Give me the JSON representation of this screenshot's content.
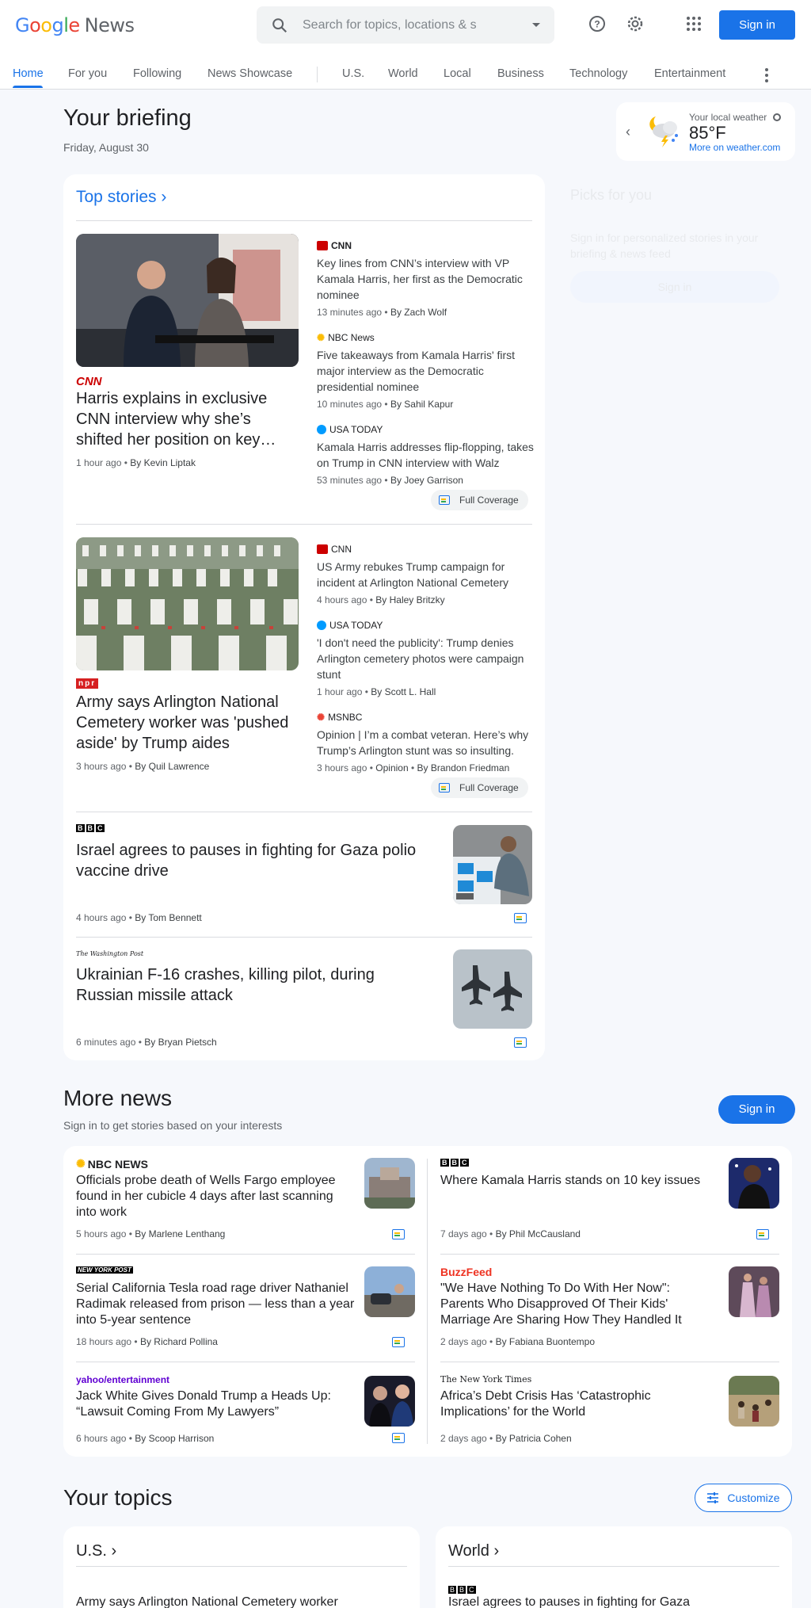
{
  "header": {
    "logo_google": "Google",
    "logo_news": "News",
    "search_placeholder": "Search for topics, locations & s",
    "signin": "Sign in",
    "tabs": [
      "Home",
      "For you",
      "Following",
      "News Showcase",
      "U.S.",
      "World",
      "Local",
      "Business",
      "Technology",
      "Entertainment"
    ],
    "active_tab": "Home"
  },
  "briefing": {
    "title": "Your briefing",
    "date": "Friday, August 30"
  },
  "weather": {
    "label": "Your local weather",
    "temp": "85°F",
    "link": "More on weather.com"
  },
  "top_stories": {
    "title": "Top stories",
    "cluster1": {
      "main_source": "CNN",
      "main_title": "Harris explains in exclusive CNN interview why she’s shifted her position on key…",
      "main_time": "1 hour ago",
      "main_author": "By Kevin Liptak",
      "related": [
        {
          "source": "CNN",
          "title": "Key lines from CNN’s interview with VP Kamala Harris, her first as the Democratic nominee",
          "time": "13 minutes ago",
          "author": "By Zach Wolf"
        },
        {
          "source": "NBC News",
          "title": "Five takeaways from Kamala Harris' first major interview as the Democratic presidential nominee",
          "time": "10 minutes ago",
          "author": "By Sahil Kapur"
        },
        {
          "source": "USA TODAY",
          "title": "Kamala Harris addresses flip-flopping, takes on Trump in CNN interview with Walz",
          "time": "53 minutes ago",
          "author": "By Joey Garrison"
        }
      ],
      "full_coverage": "Full Coverage"
    },
    "cluster2": {
      "main_source": "npr",
      "main_title": "Army says Arlington National Cemetery worker was 'pushed aside' by Trump aides",
      "main_time": "3 hours ago",
      "main_author": "By Quil Lawrence",
      "related": [
        {
          "source": "CNN",
          "title": "US Army rebukes Trump campaign for incident at Arlington National Cemetery",
          "time": "4 hours ago",
          "author": "By Haley Britzky"
        },
        {
          "source": "USA TODAY",
          "title": "'I don't need the publicity': Trump denies Arlington cemetery photos were campaign stunt",
          "time": "1 hour ago",
          "author": "By Scott L. Hall"
        },
        {
          "source": "MSNBC",
          "title": "Opinion | I’m a combat veteran. Here’s why Trump’s Arlington stunt was so insulting.",
          "time": "3 hours ago",
          "extra": "Opinion",
          "author": "By Brandon Friedman"
        }
      ],
      "full_coverage": "Full Coverage"
    },
    "single1": {
      "source": "BBC",
      "title": "Israel agrees to pauses in fighting for Gaza polio vaccine drive",
      "time": "4 hours ago",
      "author": "By Tom Bennett"
    },
    "single2": {
      "source": "The Washington Post",
      "title": "Ukrainian F-16 crashes, killing pilot, during Russian missile attack",
      "time": "6 minutes ago",
      "author": "By Bryan Pietsch"
    }
  },
  "picks": {
    "title": "Picks for you",
    "text": "Sign in for personalized stories in your briefing & news feed",
    "button": "Sign in"
  },
  "more_news": {
    "title": "More news",
    "subtitle": "Sign in to get stories based on your interests",
    "signin": "Sign in",
    "items": [
      {
        "source": "NBC NEWS",
        "title": "Officials probe death of Wells Fargo employee found in her cubicle 4 days after last scanning into work",
        "time": "5 hours ago",
        "author": "By Marlene Lenthang"
      },
      {
        "source": "BBC",
        "title": "Where Kamala Harris stands on 10 key issues",
        "time": "7 days ago",
        "author": "By Phil McCausland"
      },
      {
        "source": "NEW YORK POST",
        "title": "Serial California Tesla road rage driver Nathaniel Radimak released from prison — less than a year into 5-year sentence",
        "time": "18 hours ago",
        "author": "By Richard Pollina"
      },
      {
        "source": "BuzzFeed",
        "title": "\"We Have Nothing To Do With Her Now\": Parents Who Disapproved Of Their Kids' Marriage Are Sharing How They Handled It",
        "time": "2 days ago",
        "author": "By Fabiana Buontempo"
      },
      {
        "source": "yahoo/entertainment",
        "title": "Jack White Gives Donald Trump a Heads Up: “Lawsuit Coming From My Lawyers”",
        "time": "6 hours ago",
        "author": "By Scoop Harrison"
      },
      {
        "source": "The New York Times",
        "title": "Africa’s Debt Crisis Has ‘Catastrophic Implications’ for the World",
        "time": "2 days ago",
        "author": "By Patricia Cohen"
      }
    ]
  },
  "topics": {
    "title": "Your topics",
    "customize": "Customize",
    "cards": [
      {
        "name": "U.S.",
        "story": "Army says Arlington National Cemetery worker"
      },
      {
        "name": "World",
        "source": "BBC",
        "story": "Israel agrees to pauses in fighting for Gaza"
      }
    ]
  },
  "colors": {
    "accent": "#1a73e8",
    "cnn_red": "#cc0000",
    "buzzfeed_red": "#ee3322",
    "yahoo_purple": "#6001d2"
  }
}
